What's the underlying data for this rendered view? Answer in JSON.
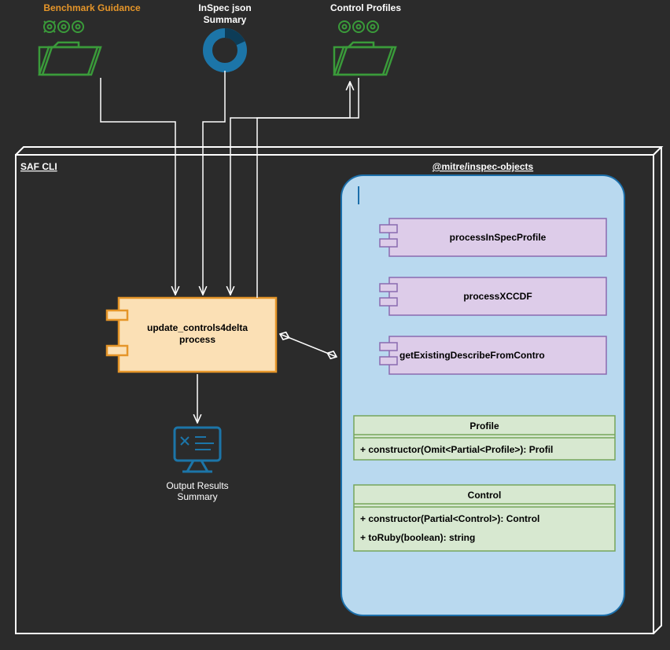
{
  "top": {
    "benchmark_label": "Benchmark Guidance",
    "inspec_label": "InSpec json\nSummary",
    "control_profiles_label": "Control Profiles"
  },
  "saf": {
    "title": "SAF CLI",
    "process_label": "update_controls4delta\nprocess",
    "output_label": "Output Results\nSummary"
  },
  "objects": {
    "title": "@mitre/inspec-objects",
    "fn1": "processInSpecProfile",
    "fn2": "processXCCDF",
    "fn3": "getExistingDescribeFromContro",
    "profile_title": "Profile",
    "profile_method": "+ constructor(Omit<Partial<Profile>): Profil",
    "control_title": "Control",
    "control_m1": "+ constructor(Partial<Control>): Control",
    "control_m2": "+ toRuby(boolean): string"
  },
  "colors": {
    "bg": "#2b2b2b",
    "green": "#3a9b3a",
    "blue_icon": "#1c75a8",
    "orange": "#e59529",
    "orange_fill": "#fbe0b5",
    "blue_fill": "#b9d9ef",
    "lilac": "#ddcce9",
    "class_fill": "#d7e8d0",
    "class_stroke": "#76a55b"
  }
}
